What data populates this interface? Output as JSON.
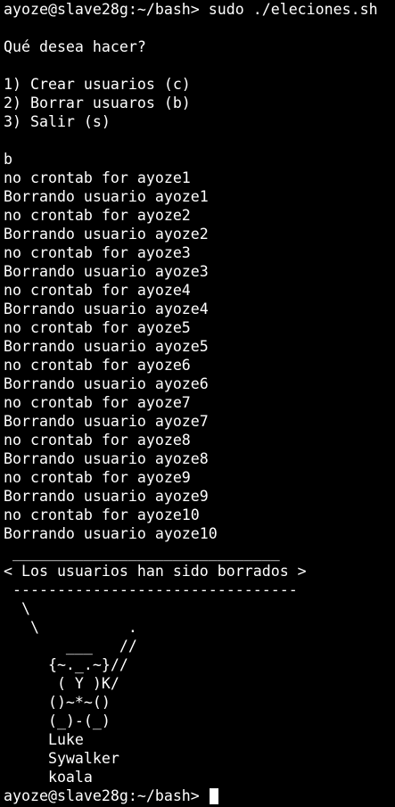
{
  "terminal": {
    "lines": [
      "ayoze@slave28g:~/bash> sudo ./eleciones.sh",
      "",
      "Qué desea hacer?",
      "",
      "1) Crear usuarios (c)",
      "2) Borrar usuaros (b)",
      "3) Salir (s)",
      "",
      "b",
      "no crontab for ayoze1",
      "Borrando usuario ayoze1",
      "no crontab for ayoze2",
      "Borrando usuario ayoze2",
      "no crontab for ayoze3",
      "Borrando usuario ayoze3",
      "no crontab for ayoze4",
      "Borrando usuario ayoze4",
      "no crontab for ayoze5",
      "Borrando usuario ayoze5",
      "no crontab for ayoze6",
      "Borrando usuario ayoze6",
      "no crontab for ayoze7",
      "Borrando usuario ayoze7",
      "no crontab for ayoze8",
      "Borrando usuario ayoze8",
      "no crontab for ayoze9",
      "Borrando usuario ayoze9",
      "no crontab for ayoze10",
      "Borrando usuario ayoze10",
      " ______________________________",
      "< Los usuarios han sido borrados >",
      " --------------------------------",
      "  \\",
      "   \\          .",
      "       ___   //",
      "     {~._.~}//",
      "      ( Y )K/",
      "     ()~*~()",
      "     (_)-(_)",
      "     Luke",
      "     Sywalker",
      "     koala"
    ],
    "prompt": "ayoze@slave28g:~/bash> "
  },
  "colors": {
    "background": "#000000",
    "foreground": "#ffffff"
  }
}
